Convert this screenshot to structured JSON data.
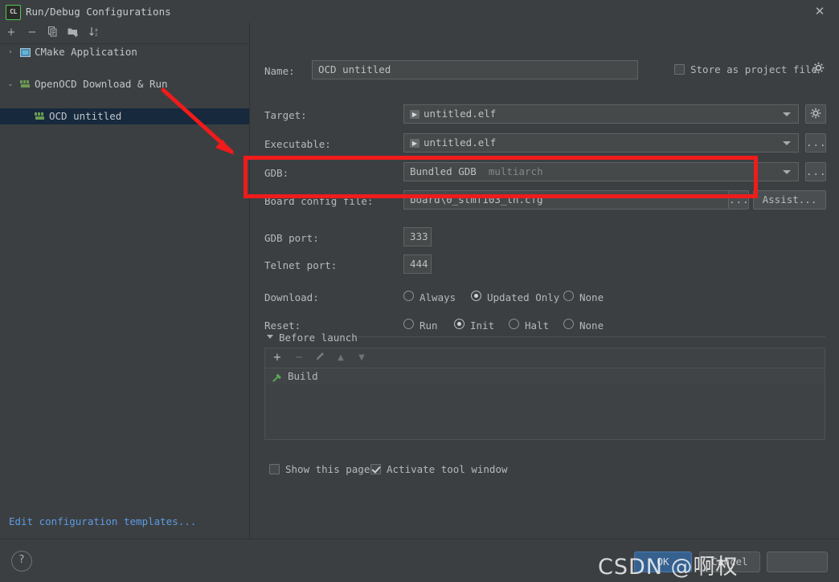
{
  "window": {
    "title": "Run/Debug Configurations",
    "app_icon": "CL",
    "close_icon": "close-icon"
  },
  "sidebar": {
    "toolbar": [
      {
        "name": "add-button",
        "glyph": "+"
      },
      {
        "name": "remove-button",
        "glyph": "−"
      },
      {
        "name": "copy-configuration-button",
        "glyph": "❐"
      },
      {
        "name": "new-folder-button",
        "glyph": "Ὄ1"
      },
      {
        "name": "sort-configurations-button",
        "glyph": "↓"
      }
    ],
    "tree": [
      {
        "label": "CMake Application",
        "twisty": "›",
        "icon": "cmake-icon",
        "indent": 26,
        "selected": false
      },
      {
        "label": "OpenOCD Download & Run",
        "twisty": "⌄",
        "icon": "ocd-icon",
        "indent": 26,
        "selected": false
      },
      {
        "label": "OCD untitled",
        "twisty": "",
        "icon": "ocd-icon",
        "indent": 62,
        "selected": true
      }
    ],
    "edit_templates_link": "Edit configuration templates..."
  },
  "form": {
    "name_label": "Name:",
    "name_value": "OCD untitled",
    "store_as_project_file_label": "Store as project file",
    "store_as_project_file_checked": false,
    "store_gear_icon": "gear-icon",
    "target_label": "Target:",
    "target_value": "untitled.elf",
    "target_gear_icon": "gear-icon",
    "executable_label": "Executable:",
    "executable_value": "untitled.elf",
    "executable_browse_label": "...",
    "gdb_label": "GDB:",
    "gdb_value": "Bundled GDB",
    "gdb_value_suffix": "multiarch",
    "gdb_browse_label": "...",
    "board_config_label": "Board config file:",
    "board_config_value": "board\\0_stmf103_lh.cfg",
    "board_browse_label": "...",
    "board_assist_label": "Assist...",
    "gdb_port_label": "GDB port:",
    "gdb_port_value": "333",
    "telnet_port_label": "Telnet port:",
    "telnet_port_value": "444",
    "download_label": "Download:",
    "download_options": [
      {
        "label": "Always",
        "selected": false
      },
      {
        "label": "Updated Only",
        "selected": true
      },
      {
        "label": "None",
        "selected": false
      }
    ],
    "reset_label": "Reset:",
    "reset_options": [
      {
        "label": "Run",
        "selected": false
      },
      {
        "label": "Init",
        "selected": true
      },
      {
        "label": "Halt",
        "selected": false
      },
      {
        "label": "None",
        "selected": false
      }
    ]
  },
  "before_launch": {
    "section_title": "Before launch",
    "toolbar": [
      {
        "name": "add-task-button",
        "glyph": "+",
        "enabled": true
      },
      {
        "name": "remove-task-button",
        "glyph": "−",
        "enabled": false
      },
      {
        "name": "edit-task-button",
        "glyph": "✎",
        "enabled": false
      },
      {
        "name": "move-up-button",
        "glyph": "▲",
        "enabled": false
      },
      {
        "name": "move-down-button",
        "glyph": "▼",
        "enabled": false
      }
    ],
    "items": [
      {
        "label": "Build",
        "icon": "hammer-icon"
      }
    ],
    "show_this_page_label": "Show this page",
    "show_this_page_checked": false,
    "activate_tool_window_label": "Activate tool window",
    "activate_tool_window_checked": true
  },
  "footer": {
    "help_icon": "?",
    "ok_label": "OK",
    "cancel_label": "Cancel",
    "apply_label": ""
  },
  "annotations": {
    "highlight_color": "#f01b1b",
    "watermark_text": "CSDN @啊权"
  }
}
